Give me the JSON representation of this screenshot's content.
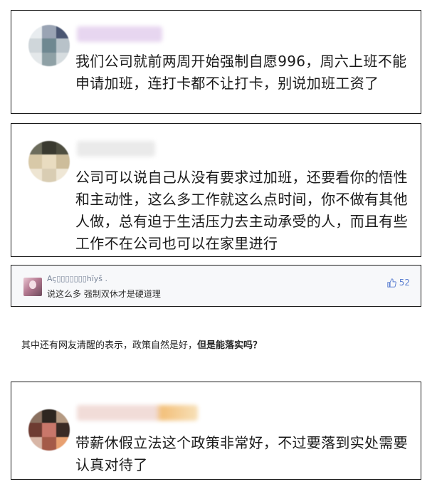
{
  "comments": [
    {
      "text": "我们公司就前两周开始强制自愿996，周六上班不能申请加班，连打卡都不让打卡，别说加班工资了"
    },
    {
      "text": "公司可以说自己从没有要求过加班，还要看你的悟性和主动性，这么多工作就这么点时间，你不做有其他人做，总有迫于生活压力去主动承受的人，而且有些工作不在公司也可以在家里进行"
    },
    {
      "text": "带薪休假立法这个政策非常好，不过要落到实处需要认真对待了"
    }
  ],
  "weibo_comment": {
    "username": "Aç▯▯▯▯▯▯▯hĩyš .",
    "text": "说这么多 强制双休才是硬道理",
    "likes": "52",
    "like_icon": "thumbs-up-icon",
    "accent_color": "#5b7fd1"
  },
  "prose": {
    "plain": "其中还有网友清醒的表示，政策自然是好，",
    "bold": "但是能落实吗？"
  }
}
